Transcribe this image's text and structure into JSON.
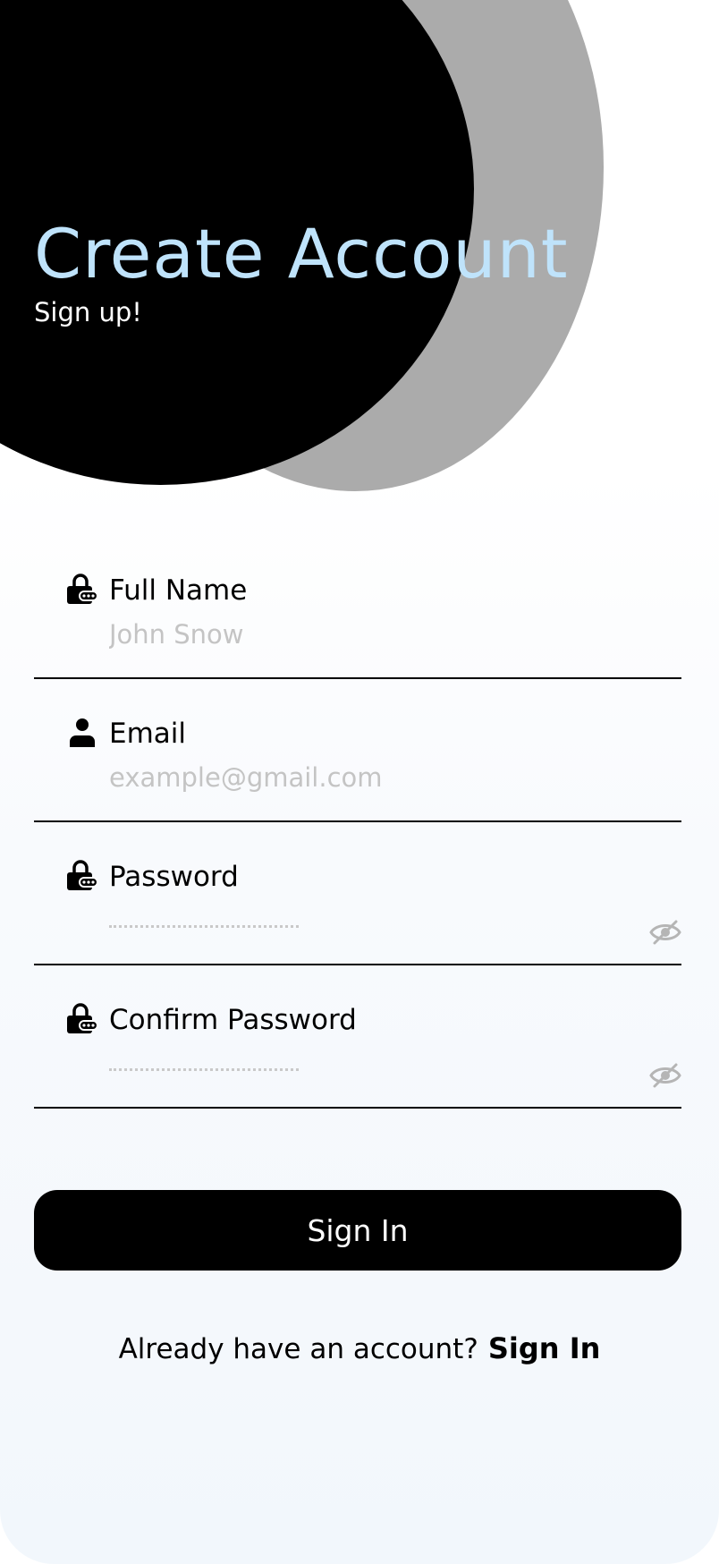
{
  "header": {
    "title": "Create Account",
    "subtitle": "Sign up!"
  },
  "form": {
    "full_name": {
      "label": "Full Name",
      "placeholder": "John Snow",
      "icon": "lock-icon"
    },
    "email": {
      "label": "Email",
      "placeholder": "example@gmail.com",
      "icon": "person-icon"
    },
    "password": {
      "label": "Password",
      "icon": "lock-icon",
      "toggle_icon": "eye-off-icon"
    },
    "confirm_password": {
      "label": "Confirm Password",
      "icon": "lock-icon",
      "toggle_icon": "eye-off-icon"
    },
    "submit_label": "Sign In"
  },
  "footer": {
    "prompt": "Already have an account?",
    "link_label": "Sign In"
  },
  "colors": {
    "title": "#bfe3fb",
    "primary": "#000000",
    "decor_gray": "#ababab",
    "placeholder": "#c4c4c4"
  }
}
